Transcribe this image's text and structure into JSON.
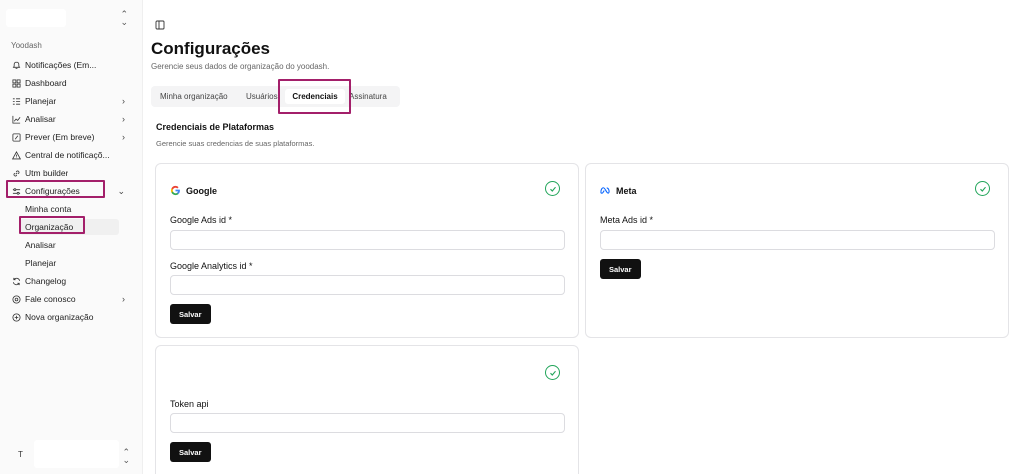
{
  "sidebar": {
    "group_label": "Yoodash",
    "items": [
      {
        "label": "Notificações (Em..."
      },
      {
        "label": "Dashboard"
      },
      {
        "label": "Planejar"
      },
      {
        "label": "Analisar"
      },
      {
        "label": "Prever (Em breve)"
      },
      {
        "label": "Central de notificaçõ..."
      },
      {
        "label": "Utm builder"
      },
      {
        "label": "Configurações"
      }
    ],
    "config_sub": [
      {
        "label": "Minha conta"
      },
      {
        "label": "Organização"
      },
      {
        "label": "Analisar"
      },
      {
        "label": "Planejar"
      }
    ],
    "bottom_items": [
      {
        "label": "Changelog"
      },
      {
        "label": "Fale conosco"
      },
      {
        "label": "Nova organização"
      }
    ],
    "user_initial": "T"
  },
  "header": {
    "title": "Configurações",
    "subtitle": "Gerencie seus dados de organização do yoodash."
  },
  "tabs": [
    {
      "label": "Minha organização"
    },
    {
      "label": "Usuários"
    },
    {
      "label": "Credenciais"
    },
    {
      "label": "Assinatura"
    }
  ],
  "section": {
    "title": "Credenciais de Plataformas",
    "subtitle": "Gerencie suas credencias de suas plataformas."
  },
  "cards": {
    "google": {
      "title": "Google",
      "field1_label": "Google Ads id *",
      "field1_value": "",
      "field2_label": "Google Analytics id *",
      "field2_value": "",
      "button": "Salvar"
    },
    "meta": {
      "title": "Meta",
      "field1_label": "Meta Ads id *",
      "field1_value": "",
      "button": "Salvar"
    },
    "token": {
      "field_label": "Token api",
      "field_value": "",
      "button": "Salvar"
    }
  },
  "colors": {
    "highlight": "#a31f6a",
    "check": "#22a55a",
    "button_bg": "#111111"
  }
}
